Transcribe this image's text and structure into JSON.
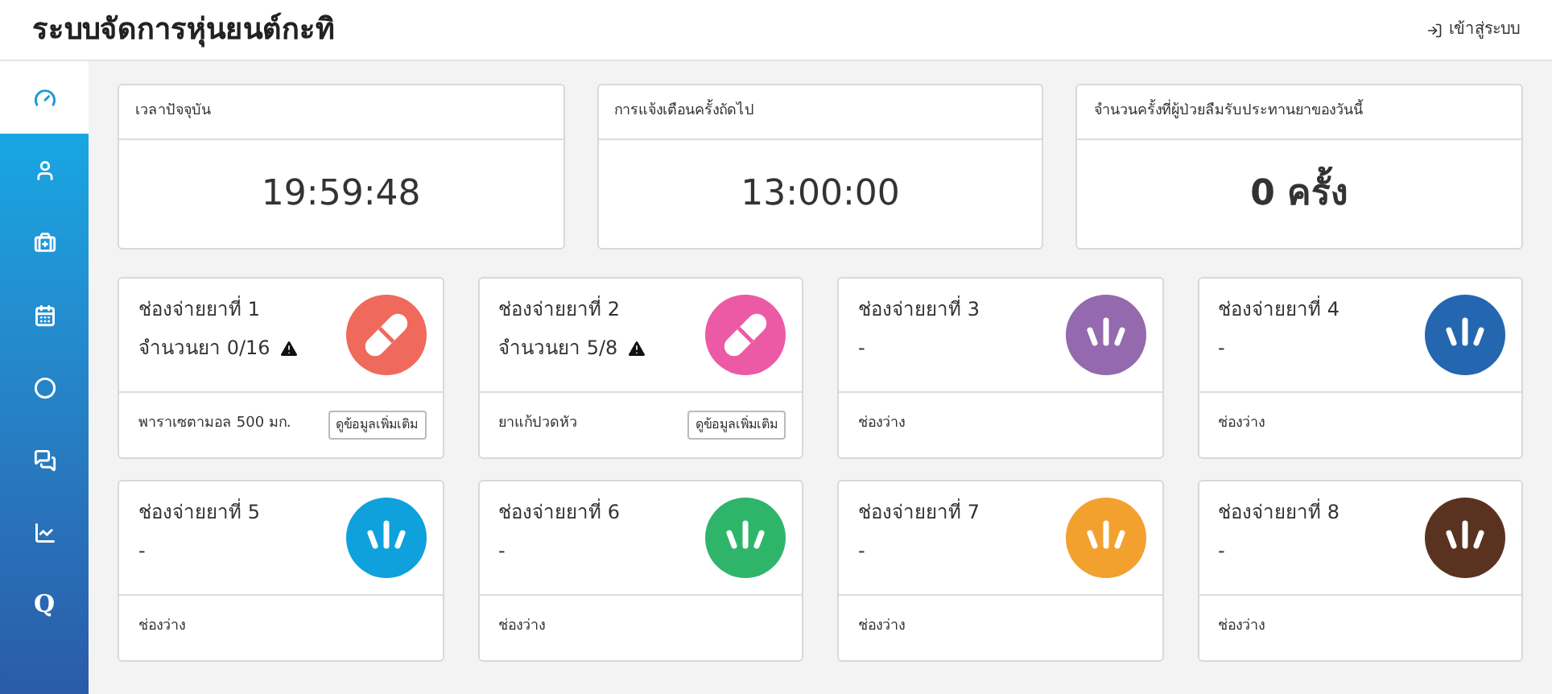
{
  "header": {
    "title": "ระบบจัดการหุ่นยนต์กะทิ",
    "login_link": "เข้าสู่ระบบ"
  },
  "sidebar": {
    "items": [
      {
        "kind": "icon",
        "selected": true
      },
      {
        "kind": "icon",
        "selected": false
      },
      {
        "kind": "icon",
        "selected": false
      },
      {
        "kind": "icon",
        "selected": false
      },
      {
        "kind": "icon",
        "selected": false
      },
      {
        "kind": "icon",
        "selected": false
      },
      {
        "kind": "icon",
        "selected": false
      },
      {
        "kind": "letter",
        "label": "Q",
        "selected": false
      }
    ]
  },
  "summary_cards": [
    {
      "heading": "เวลาปัจจุบัน",
      "value": "19:59:48",
      "bold": false
    },
    {
      "heading": "การแจ้งเตือนครั้งถัดไป",
      "value": "13:00:00",
      "bold": false
    },
    {
      "heading": "จำนวนครั้งที่ผู้ป่วยลืมรับประทานยาของวันนี้",
      "value": "0 ครั้ง",
      "bold": true
    }
  ],
  "slots": [
    {
      "kind": "pill",
      "color": "#ef6a5c",
      "title": "ช่องจ่ายยาที่ 1",
      "detail": "จำนวนยา 0/16",
      "warning": true,
      "footer": "พาราเซตามอล 500 มก.",
      "button": "ดูข้อมูลเพิ่มเติม"
    },
    {
      "kind": "pill",
      "color": "#ec5aa6",
      "title": "ช่องจ่ายยาที่ 2",
      "detail": "จำนวนยา 5/8",
      "warning": true,
      "footer": "ยาแก้ปวดหัว",
      "button": "ดูข้อมูลเพิ่มเติม"
    },
    {
      "kind": "empty",
      "color": "#9469ad",
      "title": "ช่องจ่ายยาที่ 3",
      "detail": "-",
      "warning": false,
      "footer": "ช่องว่าง"
    },
    {
      "kind": "empty",
      "color": "#2466b0",
      "title": "ช่องจ่ายยาที่ 4",
      "detail": "-",
      "warning": false,
      "footer": "ช่องว่าง"
    },
    {
      "kind": "empty",
      "color": "#0ea1dc",
      "title": "ช่องจ่ายยาที่ 5",
      "detail": "-",
      "warning": false,
      "footer": "ช่องว่าง"
    },
    {
      "kind": "empty",
      "color": "#2fb56a",
      "title": "ช่องจ่ายยาที่ 6",
      "detail": "-",
      "warning": false,
      "footer": "ช่องว่าง"
    },
    {
      "kind": "empty",
      "color": "#f2a12f",
      "title": "ช่องจ่ายยาที่ 7",
      "detail": "-",
      "warning": false,
      "footer": "ช่องว่าง"
    },
    {
      "kind": "empty",
      "color": "#5a3220",
      "title": "ช่องจ่ายยาที่ 8",
      "detail": "-",
      "warning": false,
      "footer": "ช่องว่าง"
    }
  ]
}
